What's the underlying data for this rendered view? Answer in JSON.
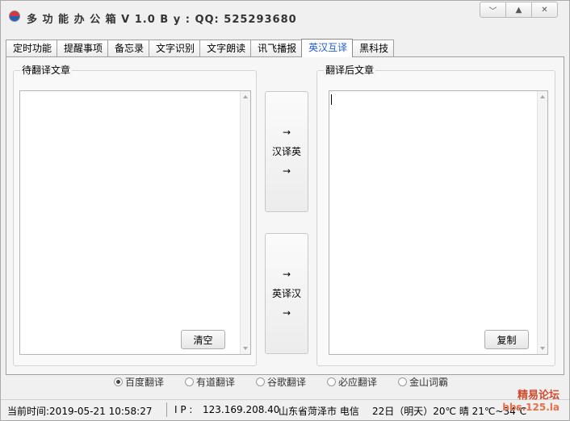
{
  "window": {
    "title": "多 功 能 办 公 箱 V 1.0    B y : QQ:  525293680",
    "controls": {
      "minimize": "﹀",
      "maximize": "▲",
      "close": "✕"
    }
  },
  "tabs": [
    "定时功能",
    "提醒事项",
    "备忘录",
    "文字识别",
    "文字朗读",
    "讯飞播报",
    "英汉互译",
    "黑科技"
  ],
  "active_tab": "英汉互译",
  "source_panel": {
    "title": "待翻译文章",
    "value": "",
    "clear_button": "清空"
  },
  "result_panel": {
    "title": "翻译后文章",
    "value": "",
    "copy_button": "复制"
  },
  "translate_buttons": {
    "cn_to_en": {
      "top_arrow": "→",
      "label": "汉译英",
      "bottom_arrow": "→"
    },
    "en_to_cn": {
      "top_arrow": "→",
      "label": "英译汉",
      "bottom_arrow": "→"
    }
  },
  "engines": [
    {
      "label": "百度翻译",
      "selected": true
    },
    {
      "label": "有道翻译",
      "selected": false
    },
    {
      "label": "谷歌翻译",
      "selected": false
    },
    {
      "label": "必应翻译",
      "selected": false
    },
    {
      "label": "金山词霸",
      "selected": false
    }
  ],
  "status": {
    "time": "当前时间:2019-05-21 10:58:27",
    "ip_label": "I P :",
    "ip": "123.169.208.40",
    "location": "山东省菏泽市 电信",
    "weather": "22日（明天）20℃ 晴 21℃~34℃"
  },
  "watermark": {
    "line1": "精易论坛",
    "line2": "bbs.125.la"
  }
}
